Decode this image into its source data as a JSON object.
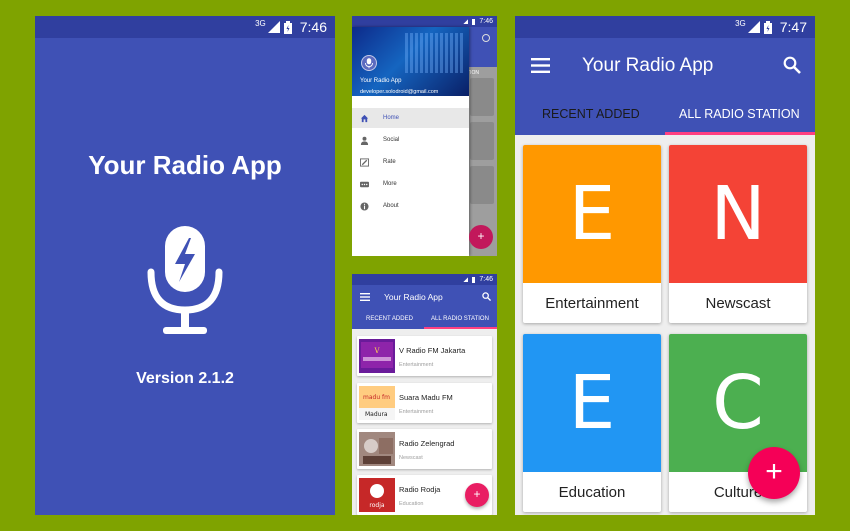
{
  "splash": {
    "status_time": "7:46",
    "network": "3G",
    "title": "Your Radio App",
    "version": "Version 2.1.2"
  },
  "drawer_screen": {
    "status_time": "7:46",
    "header_app_name": "Your Radio App",
    "header_email": "developer.solodroid@gmail.com",
    "behind_tab_text": "TION",
    "menu": [
      {
        "label": "Home",
        "icon": "home-icon"
      },
      {
        "label": "Social",
        "icon": "person-icon"
      },
      {
        "label": "Rate",
        "icon": "rate-icon"
      },
      {
        "label": "More",
        "icon": "more-icon"
      },
      {
        "label": "About",
        "icon": "info-icon"
      }
    ]
  },
  "list_screen": {
    "status_time": "7:46",
    "title": "Your Radio App",
    "tabs": [
      "RECENT ADDED",
      "ALL RADIO STATION"
    ],
    "items": [
      {
        "name": "V Radio FM Jakarta",
        "category": "Entertainment"
      },
      {
        "name": "Suara Madu FM",
        "category": "Entertainment",
        "thumb_text": "madu fm",
        "thumb_sub": "Madura"
      },
      {
        "name": "Radio Zelengrad",
        "category": "Newscast"
      },
      {
        "name": "Radio Rodja",
        "category": "Education",
        "thumb_text": "rodja"
      }
    ],
    "fab": "+"
  },
  "category_screen": {
    "status_time": "7:47",
    "network": "3G",
    "title": "Your Radio App",
    "tabs": [
      "RECENT ADDED",
      "ALL RADIO STATION"
    ],
    "categories": [
      {
        "letter": "E",
        "label": "Entertainment",
        "color": "#ff9800"
      },
      {
        "letter": "N",
        "label": "Newscast",
        "color": "#f44336"
      },
      {
        "letter": "E",
        "label": "Education",
        "color": "#2196f3"
      },
      {
        "letter": "C",
        "label": "Culture",
        "color": "#4caf50"
      }
    ],
    "fab": "+"
  },
  "colors": {
    "primary": "#3f51b5",
    "primary_dark": "#303f9f",
    "accent": "#ff4081",
    "background": "#7fa300"
  }
}
